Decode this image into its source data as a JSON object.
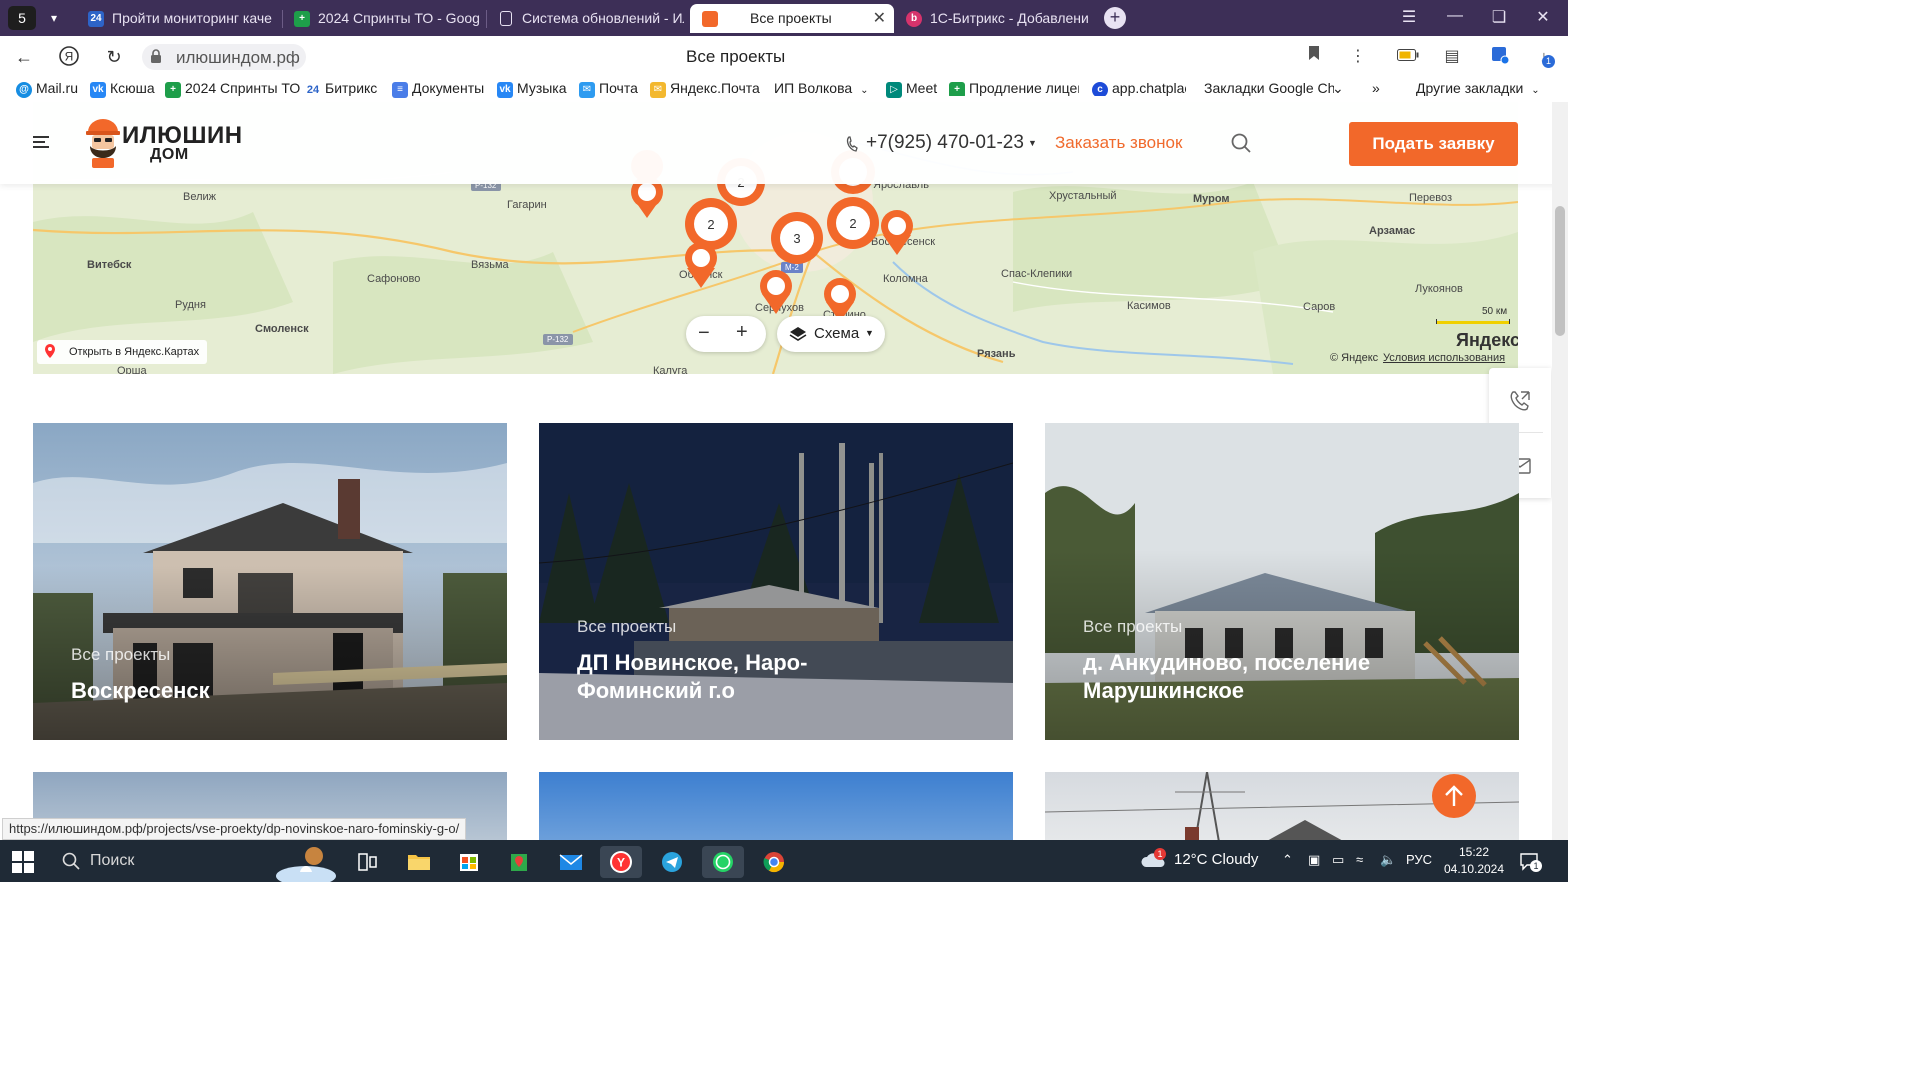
{
  "browser": {
    "tab_counter": "5",
    "tabs": [
      {
        "label": "Пройти мониторинг каче"
      },
      {
        "label": "2024 Спринты ТО - Googl"
      },
      {
        "label": "Система обновлений - Ил"
      },
      {
        "label": "Все проекты"
      },
      {
        "label": "1С-Битрикс - Добавлени"
      }
    ],
    "url": "илюшиндом.рф",
    "page_title": "Все проекты",
    "bookmarks": [
      {
        "label": "Mail.ru"
      },
      {
        "label": "Ксюша"
      },
      {
        "label": "2024 Спринты ТО"
      },
      {
        "label": "Битрикс"
      },
      {
        "label": "Документы"
      },
      {
        "label": "Музыка"
      },
      {
        "label": "Почта"
      },
      {
        "label": "Яндекс.Почта"
      },
      {
        "label": "ИП Волкова"
      },
      {
        "label": "Meet"
      },
      {
        "label": "Продление лицен"
      },
      {
        "label": "app.chatplac"
      },
      {
        "label": "Закладки Google Ch"
      },
      {
        "label": "»"
      },
      {
        "label": "Другие закладки"
      }
    ],
    "download_badge": "1",
    "status_url": "https://илюшиндом.рф/projects/vse-proekty/dp-novinskoe-naro-fominskiy-g-o/"
  },
  "site": {
    "logo_line1": "ИЛЮШИН",
    "logo_line2": "ДОМ",
    "phone": "+7(925) 470-01-23",
    "callback": "Заказать звонок",
    "apply_button": "Подать заявку"
  },
  "map": {
    "cities": [
      {
        "name": "Велиж"
      },
      {
        "name": "Гагарин"
      },
      {
        "name": "Витебск"
      },
      {
        "name": "Сафоново"
      },
      {
        "name": "Вязьма"
      },
      {
        "name": "Рудня"
      },
      {
        "name": "Смоленск"
      },
      {
        "name": "Орша"
      },
      {
        "name": "Обнинск"
      },
      {
        "name": "Серпухов"
      },
      {
        "name": "Ступино"
      },
      {
        "name": "Коломна"
      },
      {
        "name": "Воскресенск"
      },
      {
        "name": "Рязань"
      },
      {
        "name": "Калуга"
      },
      {
        "name": "Хрустальный"
      },
      {
        "name": "Спас-Клепики"
      },
      {
        "name": "Муром"
      },
      {
        "name": "Касимов"
      },
      {
        "name": "Саров"
      },
      {
        "name": "Арзамас"
      },
      {
        "name": "Перевоз"
      },
      {
        "name": "Лукоянов"
      },
      {
        "name": "Ярославль"
      }
    ],
    "roads": [
      "Р-132",
      "Р-132",
      "М-2"
    ],
    "cluster_counts": [
      "2",
      "2",
      "3",
      "2"
    ],
    "zoom_out": "−",
    "zoom_in": "+",
    "layer_label": "Схема",
    "open_link": "Открыть в Яндекс.Картах",
    "scale": "50 км",
    "copyright": "© Яндекс",
    "terms": "Условия использования",
    "brand": "Яндекс"
  },
  "projects": [
    {
      "category": "Все проекты",
      "title": "Воскресенск"
    },
    {
      "category": "Все проекты",
      "title": "ДП Новинское, Наро-Фоминский г.о"
    },
    {
      "category": "Все проекты",
      "title": "д. Анкудиново, поселение Марушкинское"
    }
  ],
  "taskbar": {
    "search_label": "Поиск",
    "weather": "12°C  Cloudy",
    "weather_badge": "1",
    "lang": "РУС",
    "time": "15:22",
    "date": "04.10.2024",
    "notif_count": "1"
  },
  "colors": {
    "accent": "#f2682a",
    "tabbar": "#3d2f57",
    "taskbar": "#1f2a36",
    "map_land": "#e9efd8"
  }
}
